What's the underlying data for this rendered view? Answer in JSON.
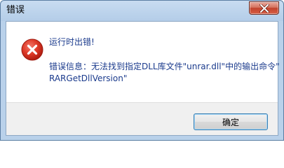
{
  "window": {
    "title": "错误"
  },
  "titlebar": {
    "close_icon": "close-icon"
  },
  "message": {
    "icon": "error-icon",
    "heading": "运行时出错!",
    "detail_line1": "错误信息：无法找到指定DLL库文件\"unrar.dll\"中的输出命令\"",
    "detail_line2": "RARGetDllVersion\""
  },
  "footer": {
    "ok_label": "确定"
  },
  "colors": {
    "message_text": "#1a3a8c",
    "error_red": "#d42b1e",
    "close_button_red": "#c1432d"
  }
}
